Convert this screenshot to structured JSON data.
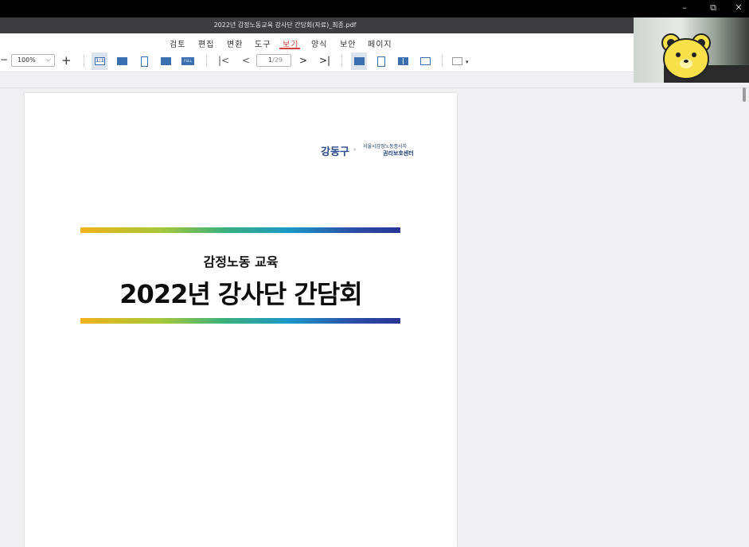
{
  "window": {
    "controls": [
      "–",
      "⧉",
      "✕"
    ]
  },
  "document": {
    "title": "2022년 감정노동교육 강사단 간담회(자료)_최종.pdf"
  },
  "menu": {
    "items": [
      "검토",
      "편집",
      "변환",
      "도구",
      "보기",
      "양식",
      "보안",
      "페이지"
    ],
    "active": "보기"
  },
  "toolbar": {
    "zoom_out": "−",
    "zoom_value": "100%",
    "zoom_in": "+",
    "fit_actual_label": "1:1",
    "fit_full_label": "FULL",
    "first_page": "|<",
    "prev_page": "<",
    "current_page": "1",
    "total_pages": "/29",
    "next_page": ">",
    "last_page": ">|"
  },
  "page_content": {
    "logo_left": "강동구",
    "logo_separator": "×",
    "logo_right_line1": "서울시감정노동종사자",
    "logo_right_line2": "권리보호센터",
    "subtitle": "감정노동 교육",
    "title": "2022년 강사단 간담회"
  },
  "colors": {
    "accent": "#d94040",
    "titlebar": "#000000",
    "docbar": "#3d3d3f",
    "bar_start": "#f2b21b",
    "bar_end": "#283593"
  }
}
